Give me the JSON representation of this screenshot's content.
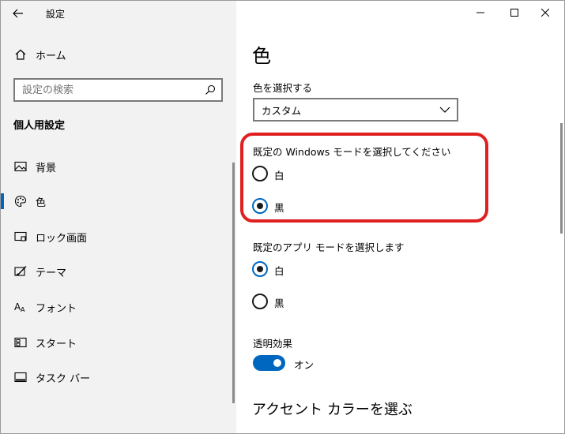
{
  "window": {
    "title": "設定",
    "controls": {
      "minimize_icon": "minimize-icon",
      "maximize_icon": "maximize-icon",
      "close_icon": "close-icon"
    }
  },
  "sidebar": {
    "home_label": "ホーム",
    "search_placeholder": "設定の検索",
    "section_heading": "個人用設定",
    "items": [
      {
        "label": "背景",
        "icon": "picture-icon",
        "selected": false
      },
      {
        "label": "色",
        "icon": "palette-icon",
        "selected": true
      },
      {
        "label": "ロック画面",
        "icon": "lock-screen-icon",
        "selected": false
      },
      {
        "label": "テーマ",
        "icon": "theme-brush-icon",
        "selected": false
      },
      {
        "label": "フォント",
        "icon": "font-icon",
        "selected": false
      },
      {
        "label": "スタート",
        "icon": "start-icon",
        "selected": false
      },
      {
        "label": "タスク バー",
        "icon": "taskbar-icon",
        "selected": false
      }
    ]
  },
  "main": {
    "page_title": "色",
    "color_select": {
      "label": "色を選択する",
      "value": "カスタム"
    },
    "windows_mode": {
      "label": "既定の Windows モードを選択してください",
      "options": [
        {
          "label": "白",
          "checked": false
        },
        {
          "label": "黒",
          "checked": true
        }
      ]
    },
    "app_mode": {
      "label": "既定のアプリ モードを選択します",
      "options": [
        {
          "label": "白",
          "checked": true
        },
        {
          "label": "黒",
          "checked": false
        }
      ]
    },
    "transparency": {
      "label": "透明効果",
      "state_label": "オン",
      "on": true
    },
    "accent_heading": "アクセント カラーを選ぶ"
  },
  "colors": {
    "accent": "#0067c0",
    "highlight": "#e02020",
    "sidebar_bg": "#f2f2f2"
  }
}
